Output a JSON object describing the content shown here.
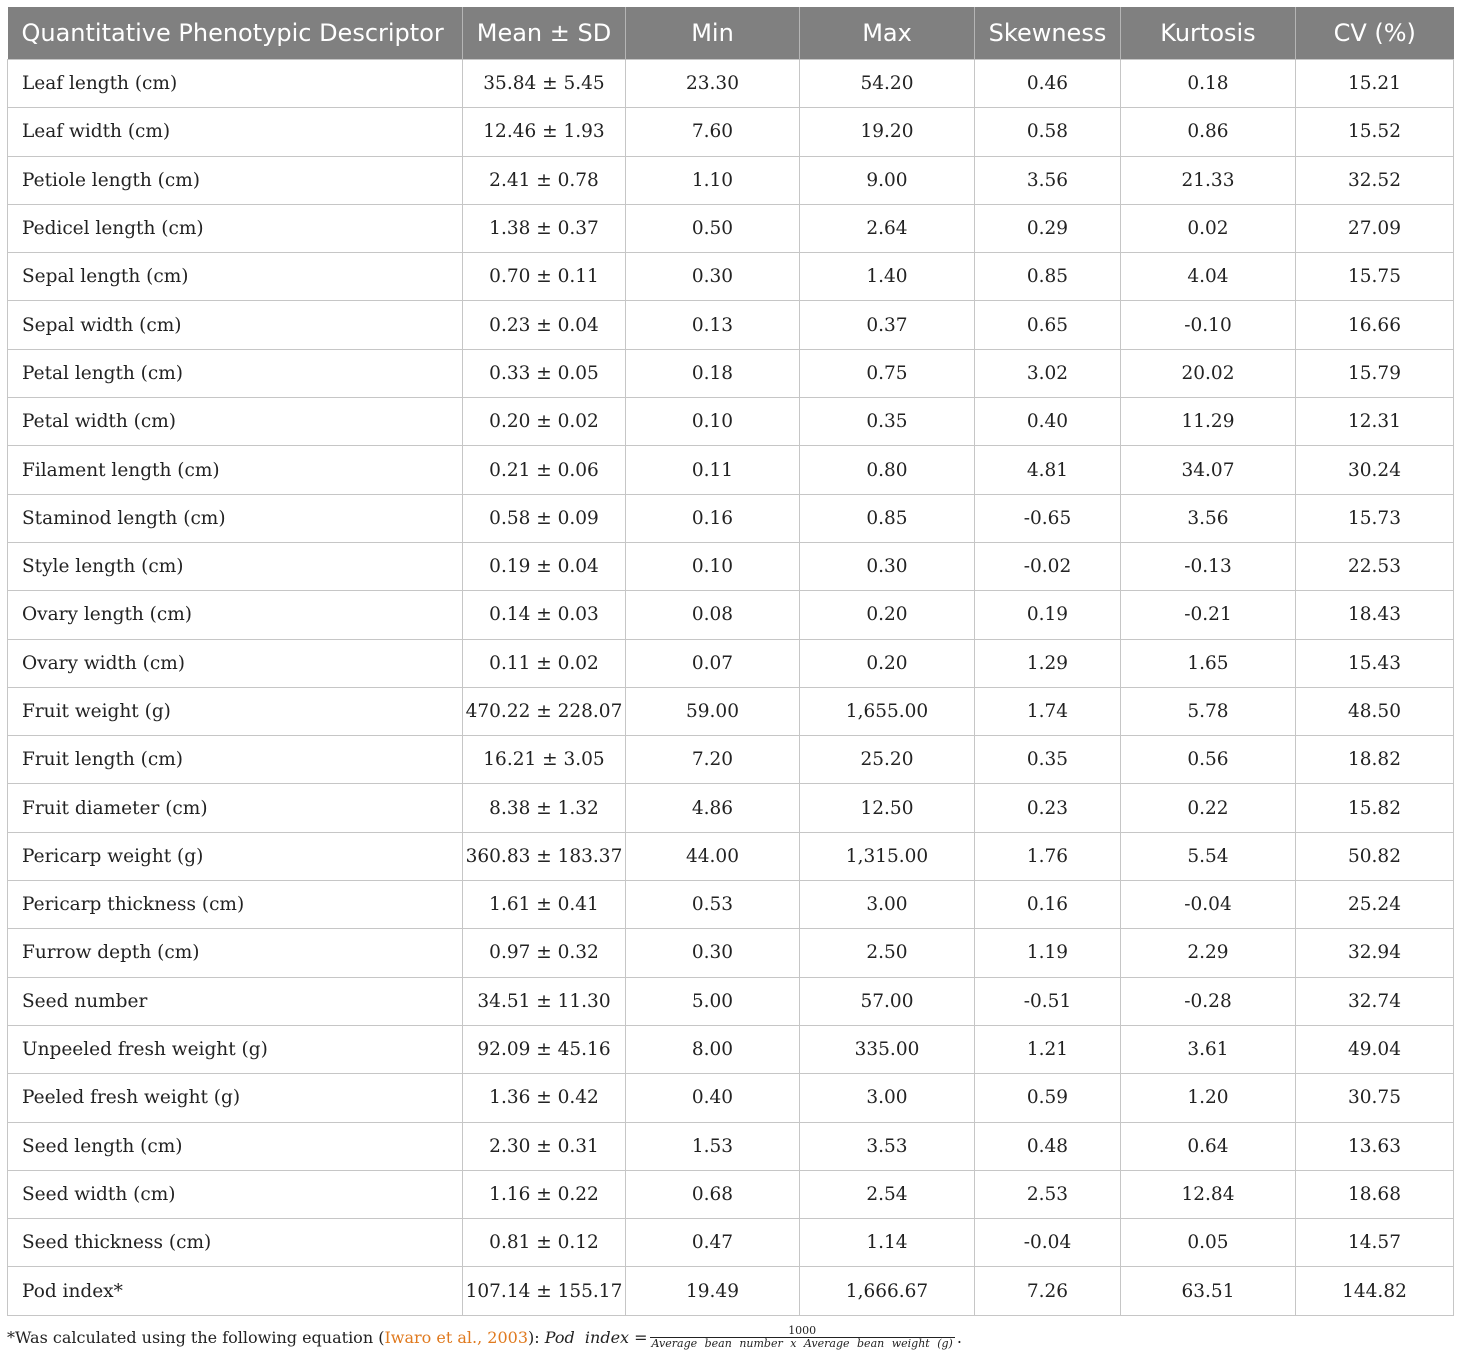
{
  "table": {
    "headers": [
      "Quantitative Phenotypic Descriptor",
      "Mean ± SD",
      "Min",
      "Max",
      "Skewness",
      "Kurtosis",
      "CV (%)"
    ],
    "rows": [
      [
        "Leaf length (cm)",
        "35.84 ± 5.45",
        "23.30",
        "54.20",
        "0.46",
        "0.18",
        "15.21"
      ],
      [
        "Leaf width (cm)",
        "12.46 ± 1.93",
        "7.60",
        "19.20",
        "0.58",
        "0.86",
        "15.52"
      ],
      [
        "Petiole length (cm)",
        "2.41 ± 0.78",
        "1.10",
        "9.00",
        "3.56",
        "21.33",
        "32.52"
      ],
      [
        "Pedicel length (cm)",
        "1.38 ± 0.37",
        "0.50",
        "2.64",
        "0.29",
        "0.02",
        "27.09"
      ],
      [
        "Sepal length (cm)",
        "0.70 ± 0.11",
        "0.30",
        "1.40",
        "0.85",
        "4.04",
        "15.75"
      ],
      [
        "Sepal width (cm)",
        "0.23 ± 0.04",
        "0.13",
        "0.37",
        "0.65",
        "-0.10",
        "16.66"
      ],
      [
        "Petal length (cm)",
        "0.33 ± 0.05",
        "0.18",
        "0.75",
        "3.02",
        "20.02",
        "15.79"
      ],
      [
        "Petal width (cm)",
        "0.20 ± 0.02",
        "0.10",
        "0.35",
        "0.40",
        "11.29",
        "12.31"
      ],
      [
        "Filament length (cm)",
        "0.21 ± 0.06",
        "0.11",
        "0.80",
        "4.81",
        "34.07",
        "30.24"
      ],
      [
        "Staminod length (cm)",
        "0.58 ± 0.09",
        "0.16",
        "0.85",
        "-0.65",
        "3.56",
        "15.73"
      ],
      [
        "Style length (cm)",
        "0.19 ± 0.04",
        "0.10",
        "0.30",
        "-0.02",
        "-0.13",
        "22.53"
      ],
      [
        "Ovary length (cm)",
        "0.14 ± 0.03",
        "0.08",
        "0.20",
        "0.19",
        "-0.21",
        "18.43"
      ],
      [
        "Ovary width (cm)",
        "0.11 ± 0.02",
        "0.07",
        "0.20",
        "1.29",
        "1.65",
        "15.43"
      ],
      [
        "Fruit weight (g)",
        "470.22 ± 228.07",
        "59.00",
        "1,655.00",
        "1.74",
        "5.78",
        "48.50"
      ],
      [
        "Fruit length (cm)",
        "16.21 ± 3.05",
        "7.20",
        "25.20",
        "0.35",
        "0.56",
        "18.82"
      ],
      [
        "Fruit diameter (cm)",
        "8.38 ± 1.32",
        "4.86",
        "12.50",
        "0.23",
        "0.22",
        "15.82"
      ],
      [
        "Pericarp weight (g)",
        "360.83 ± 183.37",
        "44.00",
        "1,315.00",
        "1.76",
        "5.54",
        "50.82"
      ],
      [
        "Pericarp thickness (cm)",
        "1.61 ± 0.41",
        "0.53",
        "3.00",
        "0.16",
        "-0.04",
        "25.24"
      ],
      [
        "Furrow depth (cm)",
        "0.97 ± 0.32",
        "0.30",
        "2.50",
        "1.19",
        "2.29",
        "32.94"
      ],
      [
        "Seed number",
        "34.51 ± 11.30",
        "5.00",
        "57.00",
        "-0.51",
        "-0.28",
        "32.74"
      ],
      [
        "Unpeeled fresh weight (g)",
        "92.09 ± 45.16",
        "8.00",
        "335.00",
        "1.21",
        "3.61",
        "49.04"
      ],
      [
        "Peeled fresh weight (g)",
        "1.36 ± 0.42",
        "0.40",
        "3.00",
        "0.59",
        "1.20",
        "30.75"
      ],
      [
        "Seed length (cm)",
        "2.30 ± 0.31",
        "1.53",
        "3.53",
        "0.48",
        "0.64",
        "13.63"
      ],
      [
        "Seed width (cm)",
        "1.16 ± 0.22",
        "0.68",
        "2.54",
        "2.53",
        "12.84",
        "18.68"
      ],
      [
        "Seed thickness (cm)",
        "0.81 ± 0.12",
        "0.47",
        "1.14",
        "-0.04",
        "0.05",
        "14.57"
      ],
      [
        "Pod index*",
        "107.14 ± 155.17",
        "19.49",
        "1,666.67",
        "7.26",
        "63.51",
        "144.82"
      ]
    ]
  },
  "footnote": {
    "marker": "*",
    "text_before": "Was calculated using the following equation (",
    "citation": "Iwaro et al., 2003",
    "text_after": "):",
    "equation_lhs": "Pod  index =",
    "numerator": "1000",
    "denominator": "Average bean number x Average bean weight (g)",
    "end": "."
  },
  "colors": {
    "header_bg": "#808080",
    "header_text": "#ffffff",
    "citation_link": "#e07a1f",
    "grid": "#c6c6c6"
  }
}
